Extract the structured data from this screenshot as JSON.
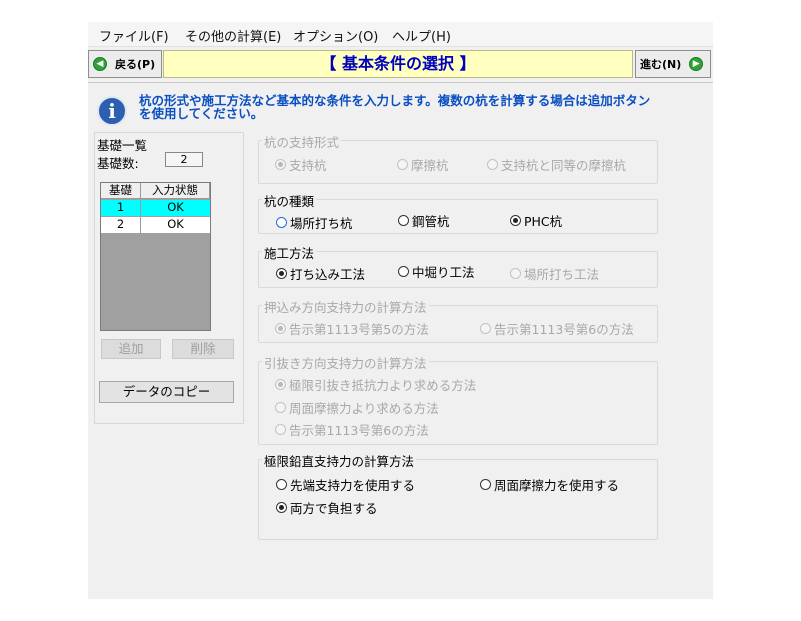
{
  "menu": [
    "ファイル(F)",
    "その他の計算(E)",
    "オプション(O)",
    "ヘルプ(H)"
  ],
  "nav": {
    "back_label": "戻る(P)",
    "next_label": "進む(N)",
    "title": "【  基本条件の選択  】"
  },
  "info": {
    "text": "杭の形式や施工方法など基本的な条件を入力します。複数の杭を計算する場合は追加ボタンを使用してください。"
  },
  "foundation": {
    "title": "基礎一覧",
    "count_label": "基礎数:",
    "count": "2",
    "columns": [
      "基礎",
      "入力状態"
    ],
    "rows": [
      {
        "id": "1",
        "status": "OK"
      },
      {
        "id": "2",
        "status": "OK"
      }
    ],
    "add_label": "追加",
    "delete_label": "削除",
    "copy_label": "データのコピー"
  },
  "groups": {
    "support_type": {
      "title": "杭の支持形式",
      "options": [
        "支持杭",
        "摩擦杭",
        "支持杭と同等の摩擦杭"
      ],
      "selected": 0
    },
    "pile_type": {
      "title": "杭の種類",
      "options": [
        "場所打ち杭",
        "鋼管杭",
        "PHC杭"
      ],
      "selected": 2
    },
    "construction": {
      "title": "施工方法",
      "options": [
        "打ち込み工法",
        "中堀り工法",
        "場所打ち工法"
      ],
      "selected": 0
    },
    "push_capacity": {
      "title": "押込み方向支持力の計算方法",
      "options": [
        "告示第1113号第5の方法",
        "告示第1113号第6の方法"
      ],
      "selected": 0
    },
    "pull_capacity": {
      "title": "引抜き方向支持力の計算方法",
      "options": [
        "極限引抜き抵抗力より求める方法",
        "周面摩擦力より求める方法",
        "告示第1113号第6の方法"
      ],
      "selected": 0
    },
    "ultimate_capacity": {
      "title": "極限鉛直支持力の計算方法",
      "options": [
        "先端支持力を使用する",
        "周面摩擦力を使用する",
        "両方で負担する"
      ],
      "selected": 2
    }
  }
}
